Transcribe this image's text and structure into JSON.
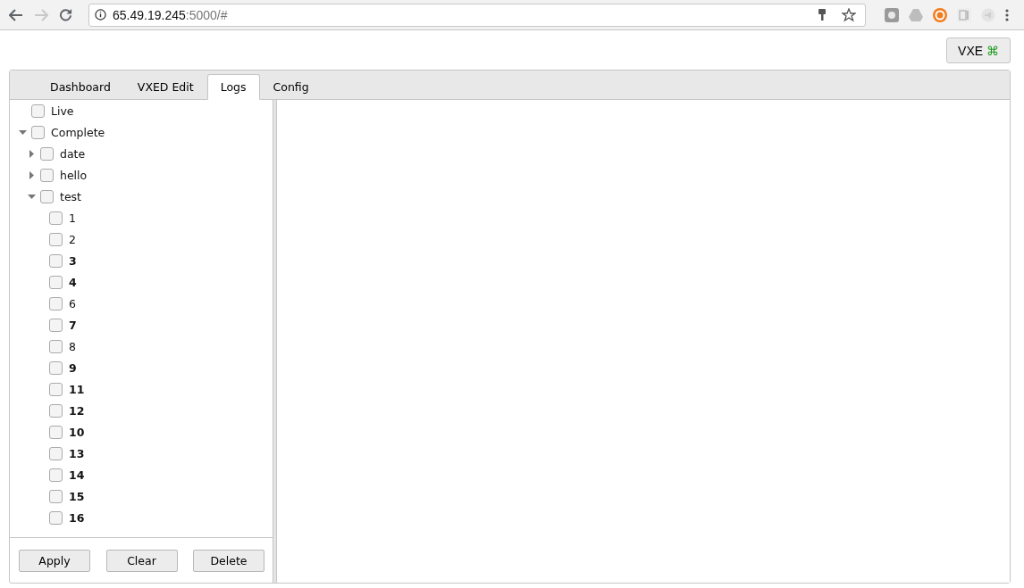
{
  "browser": {
    "url_host": "65.49.19.245",
    "url_rest": ":5000/#"
  },
  "header_button": {
    "label": "VXE",
    "symbol": "⌘"
  },
  "tabs": [
    {
      "label": "Dashboard",
      "selected": false
    },
    {
      "label": "VXED Edit",
      "selected": false
    },
    {
      "label": "Logs",
      "selected": true
    },
    {
      "label": "Config",
      "selected": false
    }
  ],
  "tree": [
    {
      "label": "Live",
      "checked": false,
      "bold": false
    },
    {
      "label": "Complete",
      "checked": false,
      "bold": false,
      "expanded": true,
      "children": [
        {
          "label": "date",
          "checked": false,
          "bold": false,
          "expanded": false
        },
        {
          "label": "hello",
          "checked": false,
          "bold": false,
          "expanded": false
        },
        {
          "label": "test",
          "checked": false,
          "bold": false,
          "expanded": true,
          "children": [
            {
              "label": "1",
              "checked": false,
              "bold": false
            },
            {
              "label": "2",
              "checked": false,
              "bold": false
            },
            {
              "label": "3",
              "checked": false,
              "bold": true
            },
            {
              "label": "4",
              "checked": false,
              "bold": true
            },
            {
              "label": "6",
              "checked": false,
              "bold": false
            },
            {
              "label": "7",
              "checked": false,
              "bold": true
            },
            {
              "label": "8",
              "checked": false,
              "bold": false
            },
            {
              "label": "9",
              "checked": false,
              "bold": true
            },
            {
              "label": "11",
              "checked": false,
              "bold": true
            },
            {
              "label": "12",
              "checked": false,
              "bold": true
            },
            {
              "label": "10",
              "checked": false,
              "bold": true
            },
            {
              "label": "13",
              "checked": false,
              "bold": true
            },
            {
              "label": "14",
              "checked": false,
              "bold": true
            },
            {
              "label": "15",
              "checked": false,
              "bold": true
            },
            {
              "label": "16",
              "checked": false,
              "bold": true
            }
          ]
        }
      ]
    }
  ],
  "buttons": [
    "Apply",
    "Clear",
    "Delete"
  ]
}
